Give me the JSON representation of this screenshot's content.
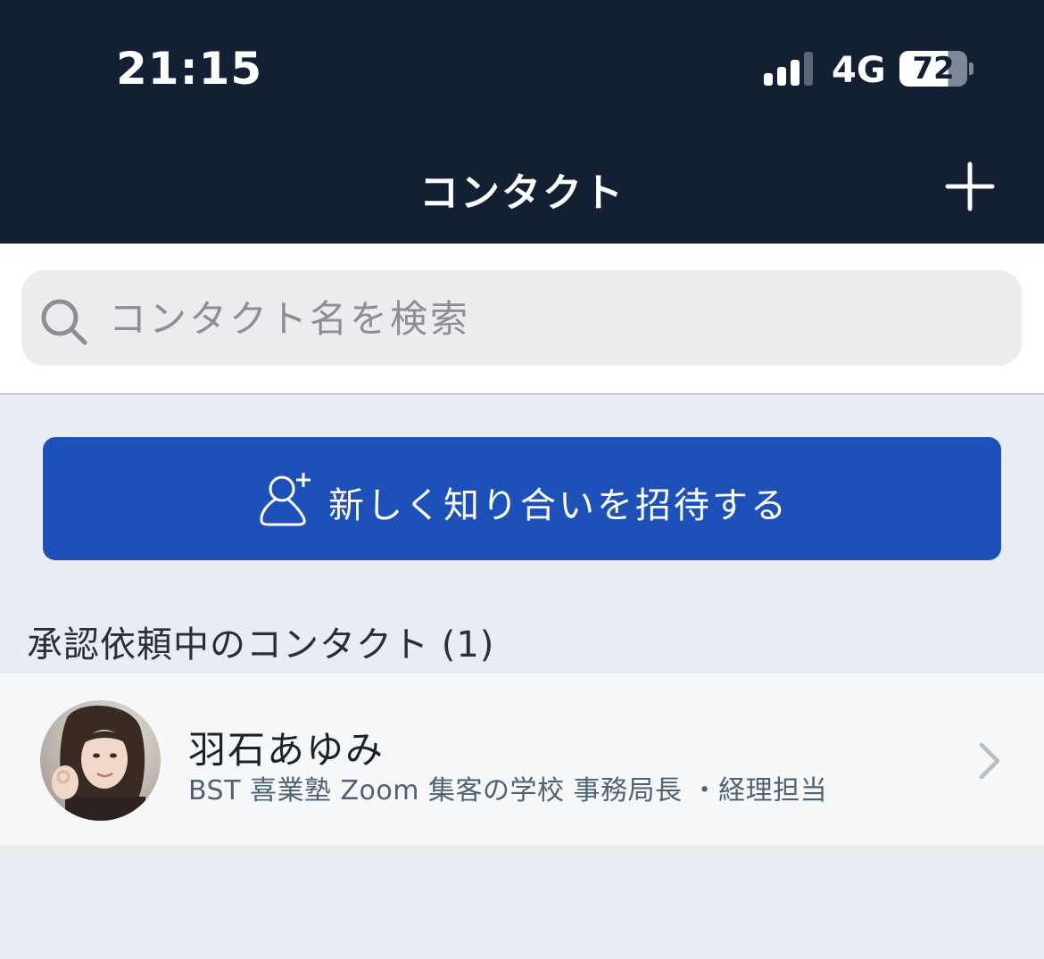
{
  "status_bar": {
    "time": "21:15",
    "network": "4G",
    "battery_level": "72",
    "signal_bars_active": 3,
    "signal_bars_total": 4
  },
  "nav_bar": {
    "title": "コンタクト",
    "add_icon": "plus-icon"
  },
  "search": {
    "placeholder": "コンタクト名を検索",
    "value": "",
    "icon": "search-icon"
  },
  "invite": {
    "label": "新しく知り合いを招待する",
    "icon": "add-person-icon"
  },
  "pending_section": {
    "title": "承認依頼中のコンタクト (1)",
    "contacts": [
      {
        "name": "羽石あゆみ",
        "title": "BST 喜業塾 Zoom 集客の学校 事務局長 ・経理担当",
        "icon": "chevron-right-icon"
      }
    ]
  },
  "colors": {
    "header_bg": "#131f33",
    "accent_blue": "#1d50b8",
    "page_bg": "#e9ecf2",
    "row_bg": "#f6f7f9"
  }
}
